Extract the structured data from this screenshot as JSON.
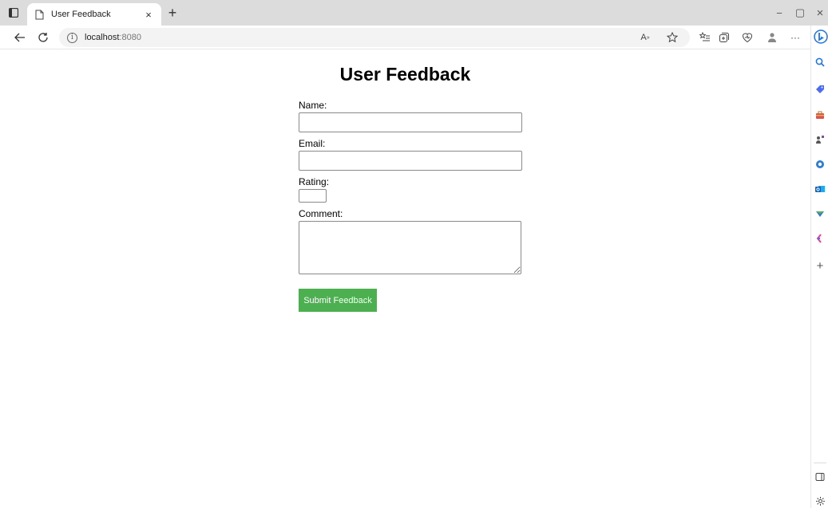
{
  "browser": {
    "tab": {
      "title": "User Feedback",
      "close": "×"
    },
    "new_tab": "+",
    "window_controls": {
      "minimize": "−",
      "restore": "▢",
      "close": "×"
    },
    "address": {
      "host": "localhost",
      "port": ":8080"
    },
    "nav_icons": [
      "back-arrow-icon",
      "reload-icon",
      "site-info-icon"
    ],
    "toolbar_icons": [
      "read-aloud-icon",
      "favorite-star-icon",
      "favorites-icon",
      "collections-icon",
      "browser-essentials-icon",
      "profile-icon",
      "more-icon"
    ],
    "read_aloud_label": "A",
    "more_label": "···",
    "sidebar_icons": [
      "bing-copilot-icon",
      "search-icon",
      "shopping-tag-icon",
      "tools-icon",
      "games-icon",
      "office-icon",
      "outlook-icon",
      "drop-icon",
      "designer-icon",
      "add-icon",
      "split-screen-icon",
      "settings-icon"
    ]
  },
  "page": {
    "title": "User Feedback",
    "form": {
      "name_label": "Name:",
      "name_value": "",
      "email_label": "Email:",
      "email_value": "",
      "rating_label": "Rating:",
      "rating_value": "",
      "comment_label": "Comment:",
      "comment_value": "",
      "submit_label": "Submit Feedback"
    }
  },
  "colors": {
    "submit_button": "#4caf50",
    "tab_strip": "#dcdcdc"
  }
}
